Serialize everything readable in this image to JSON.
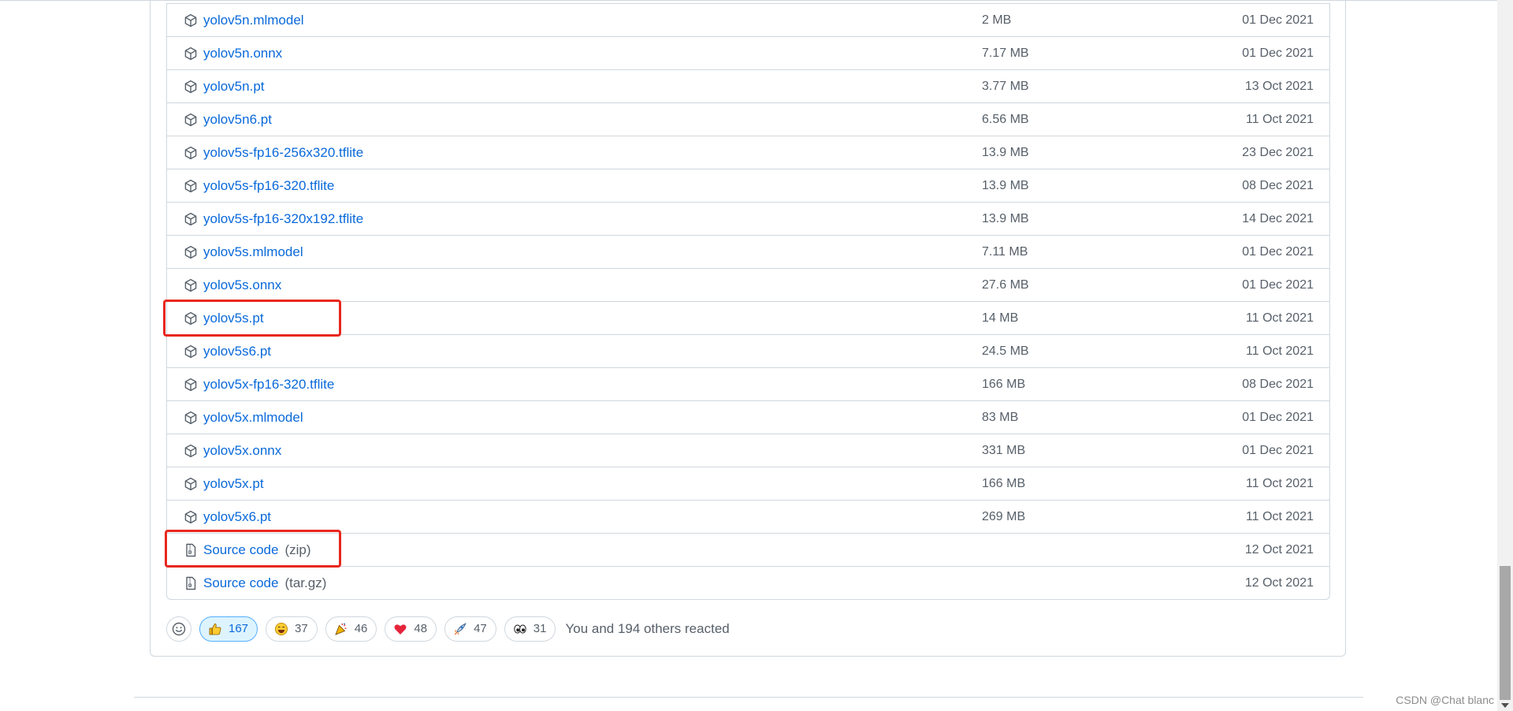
{
  "assets": [
    {
      "name": "yolov5n.mlmodel",
      "size": "2 MB",
      "date": "01 Dec 2021"
    },
    {
      "name": "yolov5n.onnx",
      "size": "7.17 MB",
      "date": "01 Dec 2021"
    },
    {
      "name": "yolov5n.pt",
      "size": "3.77 MB",
      "date": "13 Oct 2021"
    },
    {
      "name": "yolov5n6.pt",
      "size": "6.56 MB",
      "date": "11 Oct 2021"
    },
    {
      "name": "yolov5s-fp16-256x320.tflite",
      "size": "13.9 MB",
      "date": "23 Dec 2021"
    },
    {
      "name": "yolov5s-fp16-320.tflite",
      "size": "13.9 MB",
      "date": "08 Dec 2021"
    },
    {
      "name": "yolov5s-fp16-320x192.tflite",
      "size": "13.9 MB",
      "date": "14 Dec 2021"
    },
    {
      "name": "yolov5s.mlmodel",
      "size": "7.11 MB",
      "date": "01 Dec 2021"
    },
    {
      "name": "yolov5s.onnx",
      "size": "27.6 MB",
      "date": "01 Dec 2021"
    },
    {
      "name": "yolov5s.pt",
      "size": "14 MB",
      "date": "11 Oct 2021"
    },
    {
      "name": "yolov5s6.pt",
      "size": "24.5 MB",
      "date": "11 Oct 2021"
    },
    {
      "name": "yolov5x-fp16-320.tflite",
      "size": "166 MB",
      "date": "08 Dec 2021"
    },
    {
      "name": "yolov5x.mlmodel",
      "size": "83 MB",
      "date": "01 Dec 2021"
    },
    {
      "name": "yolov5x.onnx",
      "size": "331 MB",
      "date": "01 Dec 2021"
    },
    {
      "name": "yolov5x.pt",
      "size": "166 MB",
      "date": "11 Oct 2021"
    },
    {
      "name": "yolov5x6.pt",
      "size": "269 MB",
      "date": "11 Oct 2021"
    }
  ],
  "source_code": [
    {
      "name": "Source code",
      "ext": "(zip)",
      "date": "12 Oct 2021"
    },
    {
      "name": "Source code",
      "ext": "(tar.gz)",
      "date": "12 Oct 2021"
    }
  ],
  "icons": {
    "asset": "package-icon",
    "source": "file-zip-icon",
    "add_reaction": "smiley-icon"
  },
  "reactions": [
    {
      "emoji": "thumbs-up",
      "count": "167",
      "active": true
    },
    {
      "emoji": "laugh",
      "count": "37",
      "active": false
    },
    {
      "emoji": "hooray",
      "count": "46",
      "active": false
    },
    {
      "emoji": "heart",
      "count": "48",
      "active": false
    },
    {
      "emoji": "rocket",
      "count": "47",
      "active": false
    },
    {
      "emoji": "eyes",
      "count": "31",
      "active": false
    }
  ],
  "reaction_summary": "You and 194 others reacted",
  "watermark": "CSDN @Chat blanc",
  "colors": {
    "link": "#0969da",
    "muted": "#57606a",
    "border": "#d0d7de",
    "highlight": "#e8271e",
    "active_reaction_bg": "#ddf4ff"
  }
}
